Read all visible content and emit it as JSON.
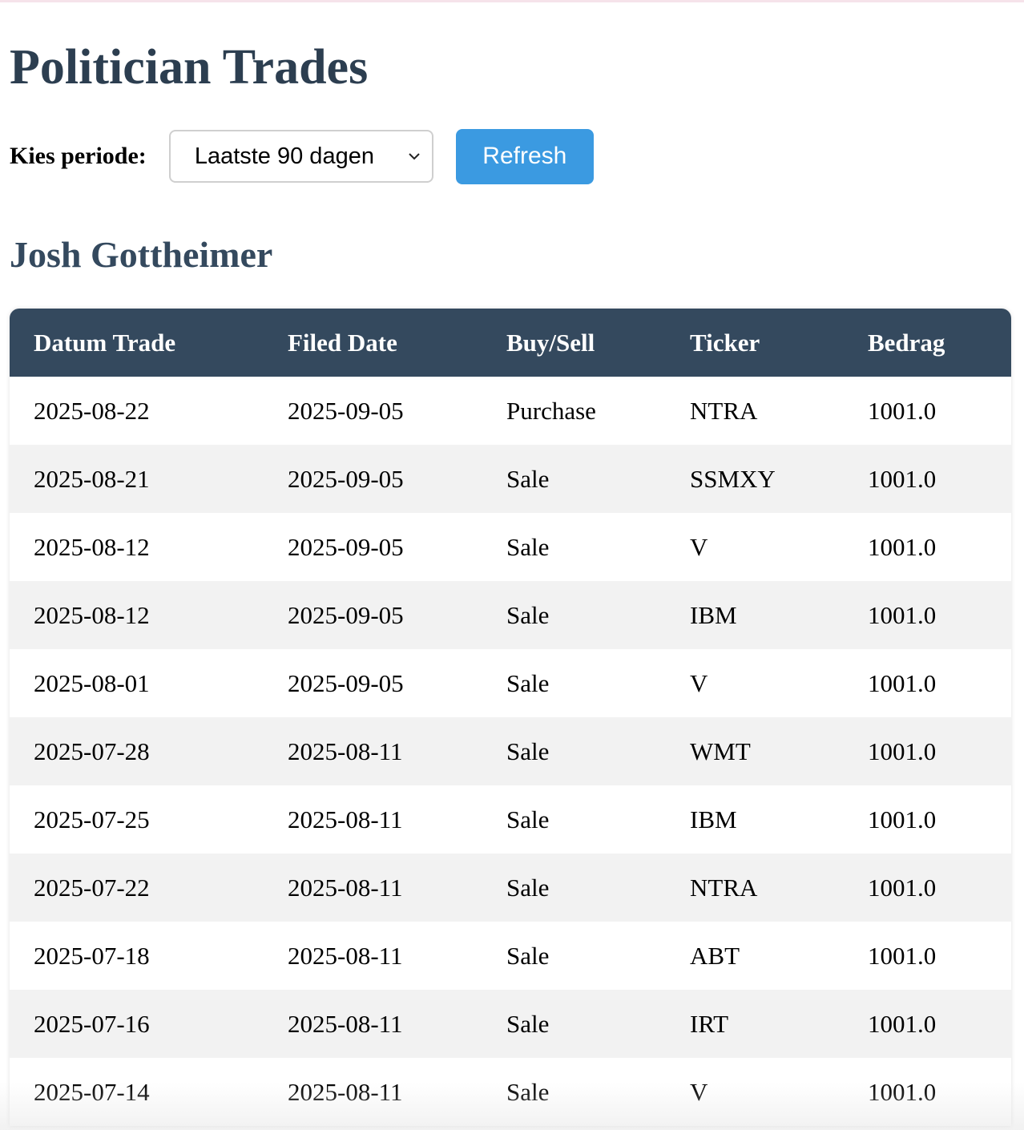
{
  "page": {
    "title": "Politician Trades"
  },
  "controls": {
    "period_label": "Kies periode:",
    "period_selected": "Laatste 90 dagen",
    "refresh_label": "Refresh"
  },
  "politician": {
    "name": "Josh Gottheimer"
  },
  "table": {
    "headers": [
      "Datum Trade",
      "Filed Date",
      "Buy/Sell",
      "Ticker",
      "Bedrag"
    ],
    "rows": [
      [
        "2025-08-22",
        "2025-09-05",
        "Purchase",
        "NTRA",
        "1001.0"
      ],
      [
        "2025-08-21",
        "2025-09-05",
        "Sale",
        "SSMXY",
        "1001.0"
      ],
      [
        "2025-08-12",
        "2025-09-05",
        "Sale",
        "V",
        "1001.0"
      ],
      [
        "2025-08-12",
        "2025-09-05",
        "Sale",
        "IBM",
        "1001.0"
      ],
      [
        "2025-08-01",
        "2025-09-05",
        "Sale",
        "V",
        "1001.0"
      ],
      [
        "2025-07-28",
        "2025-08-11",
        "Sale",
        "WMT",
        "1001.0"
      ],
      [
        "2025-07-25",
        "2025-08-11",
        "Sale",
        "IBM",
        "1001.0"
      ],
      [
        "2025-07-22",
        "2025-08-11",
        "Sale",
        "NTRA",
        "1001.0"
      ],
      [
        "2025-07-18",
        "2025-08-11",
        "Sale",
        "ABT",
        "1001.0"
      ],
      [
        "2025-07-16",
        "2025-08-11",
        "Sale",
        "IRT",
        "1001.0"
      ],
      [
        "2025-07-14",
        "2025-08-11",
        "Sale",
        "V",
        "1001.0"
      ]
    ]
  },
  "colors": {
    "title": "#2c3e50",
    "header_bg": "#34495e",
    "button_bg": "#3b9ae1",
    "row_alt": "#f2f2f2"
  },
  "icons": {
    "select_arrow": "chevron-down-icon"
  }
}
